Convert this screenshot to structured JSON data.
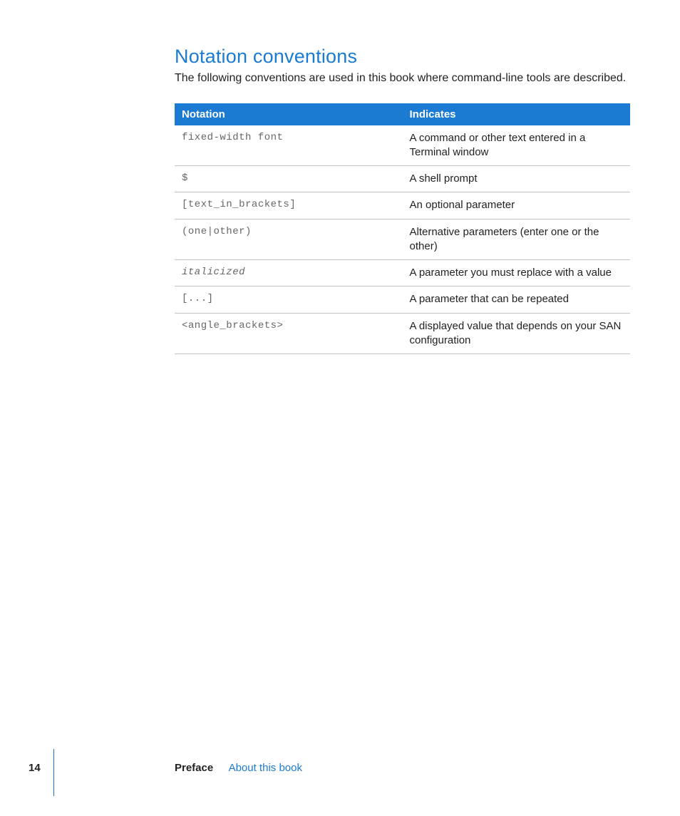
{
  "heading": "Notation conventions",
  "intro": "The following conventions are used in this book where command-line tools are described.",
  "table": {
    "headers": {
      "col1": "Notation",
      "col2": "Indicates"
    },
    "rows": [
      {
        "notation": "fixed-width font",
        "indicates": "A command or other text entered in a Terminal window",
        "italic": false
      },
      {
        "notation": "$",
        "indicates": "A shell prompt",
        "italic": false
      },
      {
        "notation": "[text_in_brackets]",
        "indicates": "An optional parameter",
        "italic": false
      },
      {
        "notation": "(one|other)",
        "indicates": "Alternative parameters (enter one or the other)",
        "italic": false
      },
      {
        "notation": "italicized",
        "indicates": "A parameter you must replace with a value",
        "italic": true
      },
      {
        "notation": "[...]",
        "indicates": "A parameter that can be repeated",
        "italic": false
      },
      {
        "notation": "<angle_brackets>",
        "indicates": "A displayed value that depends on your SAN configuration",
        "italic": false
      }
    ]
  },
  "footer": {
    "page": "14",
    "preface": "Preface",
    "about": "About this book"
  }
}
